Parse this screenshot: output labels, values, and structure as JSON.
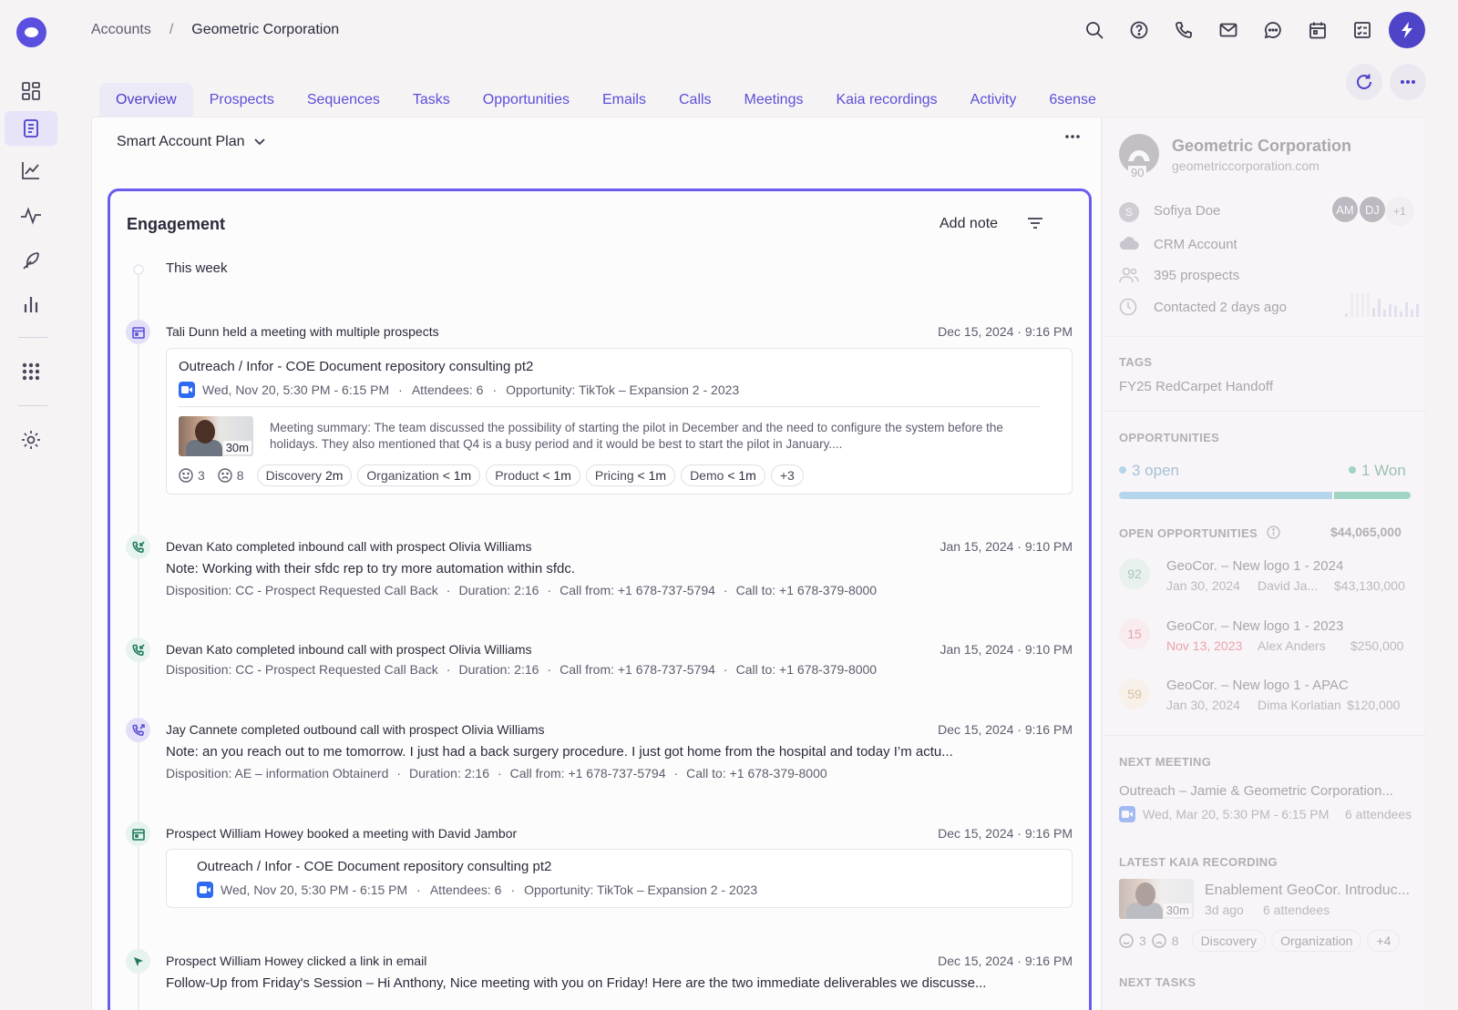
{
  "breadcrumb": {
    "parent": "Accounts",
    "separator": "/",
    "current": "Geometric Corporation"
  },
  "tabs": [
    "Overview",
    "Prospects",
    "Sequences",
    "Tasks",
    "Opportunities",
    "Emails",
    "Calls",
    "Meetings",
    "Kaia recordings",
    "Activity",
    "6sense"
  ],
  "plan_selector": "Smart Account Plan",
  "engagement": {
    "title": "Engagement",
    "add_note": "Add note",
    "week_label": "This week",
    "events": [
      {
        "title": "Tali Dunn  held a meeting  with multiple prospects",
        "time": "Dec 15, 2024 · 9:16 PM",
        "card": {
          "title": "Outreach / Infor - COE Document repository consulting pt2",
          "when": "Wed, Nov 20, 5:30 PM - 6:15 PM",
          "attendees": "Attendees: 6",
          "opportunity": "Opportunity: TikTok – Expansion 2 - 2023",
          "thumb_duration": "30m",
          "summary": "Meeting summary: The team discussed the possibility of starting the pilot in December and the need to configure the system before the holidays. They also mentioned that Q4 is a busy period and it would be best to start the pilot in January....",
          "positive": "3",
          "negative": "8",
          "chips": [
            {
              "name": "Discovery",
              "value": "2m"
            },
            {
              "name": "Organization",
              "value": "< 1m"
            },
            {
              "name": "Product",
              "value": "< 1m"
            },
            {
              "name": "Pricing",
              "value": "< 1m"
            },
            {
              "name": "Demo",
              "value": "< 1m"
            }
          ],
          "more": "+3"
        }
      },
      {
        "title": "Devan Kato completed inbound call with prospect Olivia Williams",
        "time": "Jan 15, 2024 · 9:10 PM",
        "note": "Note: Working with their sfdc rep to try more automation within sfdc.",
        "disposition": "Disposition: CC - Prospect Requested Call Back",
        "duration": "Duration: 2:16",
        "call_from": "Call from: +1 678-737-5794",
        "call_to": "Call to:  +1 678-379-8000"
      },
      {
        "title": "Devan Kato completed inbound call with prospect Olivia Williams",
        "time": "Jan 15, 2024 · 9:10 PM",
        "disposition": "Disposition: CC - Prospect Requested Call Back",
        "duration": "Duration: 2:16",
        "call_from": "Call from: +1 678-737-5794",
        "call_to": "Call to:  +1 678-379-8000"
      },
      {
        "title": "Jay Cannete completed outbound call with prospect Olivia Williams",
        "time": "Dec 15, 2024 · 9:16 PM",
        "note": "Note: an you reach out to me tomorrow. I just had a back surgery procedure. I just got home from the hospital and today I’m actu...",
        "disposition": "Disposition: AE – information Obtainerd",
        "duration": "Duration: 2:16",
        "call_from": "Call from: +1 678-737-5794",
        "call_to": "Call to:  +1 678-379-8000"
      },
      {
        "title": "Prospect William Howey booked a meeting with David Jambor",
        "time": "Dec 15, 2024 · 9:16 PM",
        "card": {
          "title": "Outreach / Infor - COE Document repository consulting pt2",
          "when": "Wed, Nov 20, 5:30 PM - 6:15 PM",
          "attendees": "Attendees: 6",
          "opportunity": "Opportunity: TikTok – Expansion 2 - 2023"
        }
      },
      {
        "title": "Prospect William Howey clicked a link in email",
        "time": "Dec 15, 2024 · 9:16 PM",
        "note": "Follow-Up from Friday's Session – Hi Anthony, Nice meeting with you on Friday! Here are the two immediate deliverables we discusse..."
      }
    ]
  },
  "side": {
    "account_name": "Geometric Corporation",
    "domain": "geometriccorporation.com",
    "score": "90",
    "owner_initial": "S",
    "owner": "Sofiya Doe",
    "avatars": [
      "AM",
      "DJ"
    ],
    "avatars_more": "+1",
    "crm": "CRM Account",
    "prospects": "395 prospects",
    "contacted": "Contacted 2 days ago",
    "tags_label": "TAGS",
    "tag": "FY25 RedCarpet Handoff",
    "opps_label": "OPPORTUNITIES",
    "open": "3 open",
    "won": "1 Won",
    "open_share": 0.73,
    "open_opps_label": "OPEN OPPORTUNITIES",
    "open_opps_total": "$44,065,000",
    "opps": [
      {
        "score": "92",
        "name": "GeoCor. – New logo 1 - 2024",
        "date": "Jan 30, 2024",
        "owner": "David Ja...",
        "amount": "$43,130,000",
        "score_color": "#d9efe6",
        "score_text": "#3a8a6a",
        "date_color": "#6a6878"
      },
      {
        "score": "15",
        "name": "GeoCor. – New logo 1 - 2023",
        "date": "Nov 13, 2023",
        "owner": "Alex Anders",
        "amount": "$250,000",
        "score_color": "#fbe3e6",
        "score_text": "#c9364f",
        "date_color": "#e0304a"
      },
      {
        "score": "59",
        "name": "GeoCor. – New logo 1 - APAC",
        "date": "Jan 30, 2024",
        "owner": "Dima Korlatian",
        "amount": "$120,000",
        "score_color": "#fbeedd",
        "score_text": "#b07a2a",
        "date_color": "#6a6878"
      }
    ],
    "next_meeting_label": "NEXT MEETING",
    "next_meeting": "Outreach – Jamie & Geometric Corporation...",
    "next_meeting_when": "Wed, Mar 20, 5:30 PM - 6:15 PM",
    "next_meeting_attendees": "6 attendees",
    "kaia_label": "LATEST KAIA RECORDING",
    "kaia_title": "Enablement GeoCor. Introduc...",
    "kaia_ago": "3d ago",
    "kaia_attendees": "6 attendees",
    "kaia_duration": "30m",
    "kaia_pos": "3",
    "kaia_neg": "8",
    "kaia_chips": [
      "Discovery",
      "Organization"
    ],
    "kaia_more": "+4",
    "next_tasks_label": "NEXT TASKS"
  },
  "colors": {
    "accent": "#5b4fe0",
    "accent_dark": "#4e44c8",
    "open_bar": "#5aaee0",
    "won_bar": "#2bae86"
  }
}
